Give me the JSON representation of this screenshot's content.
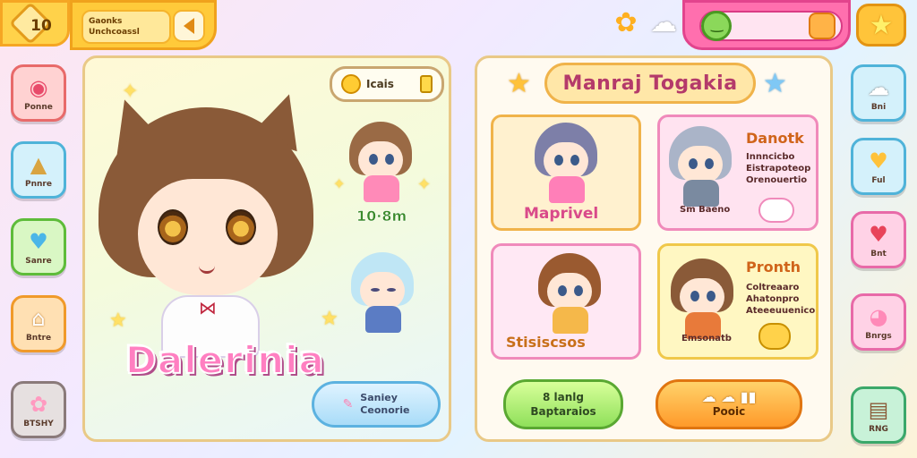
{
  "topbar": {
    "level": "10",
    "title_line1": "Gaonks",
    "title_line2": "Unchcoassl",
    "icons": {
      "level": "diamond-icon",
      "back": "back-arrow-icon",
      "flower": "flower-icon",
      "cloud": "cloud-face-icon",
      "star": "star-icon"
    }
  },
  "left_menu": [
    {
      "label": "Ponne",
      "icon": "donut-icon",
      "color": "#ff8a8a"
    },
    {
      "label": "Pnnre",
      "icon": "cake-icon",
      "color": "#7fd0f0"
    },
    {
      "label": "Sanre",
      "icon": "heart-icon",
      "color": "#8de06a"
    },
    {
      "label": "Bntre",
      "icon": "house-icon",
      "color": "#ffb347"
    },
    {
      "label": "BTSHY",
      "icon": "flower-icon",
      "color": "#bdbdbd"
    }
  ],
  "right_menu": [
    {
      "label": "Bni",
      "icon": "cloud-face-icon",
      "color": "#7fd0f0"
    },
    {
      "label": "Ful",
      "icon": "heart-icon",
      "color": "#7fd0f0"
    },
    {
      "label": "Bnt",
      "icon": "heart-icon",
      "color": "#ff8ac0"
    },
    {
      "label": "Bnrgs",
      "icon": "pig-icon",
      "color": "#ff8ac0"
    },
    {
      "label": "RNG",
      "icon": "cake-icon",
      "color": "#6ed49a"
    }
  ],
  "character": {
    "name": "Dalerinia",
    "coin_label": "Icais",
    "time_label": "10·8m",
    "action_line1": "Saniey",
    "action_line2": "Ceonorie"
  },
  "gallery": {
    "title": "Manraj Togakia",
    "cards": [
      {
        "name": "Maprivel",
        "lines": [],
        "bg": "#fff1cf"
      },
      {
        "name": "Danotk",
        "lines": [
          "Innncicbo",
          "Eistrapoteop",
          "Orenouertio"
        ],
        "sub": "Sm Baeno",
        "bg": "#ffe3f0"
      },
      {
        "name": "Stisiscsos",
        "lines": [],
        "bg": "#ffe8f4"
      },
      {
        "name": "Pronth",
        "lines": [
          "Coltreaaro",
          "Ahatonpro",
          "Ateeeuuenico"
        ],
        "sub": "Emsonatb",
        "bg": "#fff7c2"
      }
    ]
  },
  "buttons": {
    "green_line1": "8 lanlg",
    "green_line2": "Baptaraios",
    "orange_line2": "Pooic"
  }
}
